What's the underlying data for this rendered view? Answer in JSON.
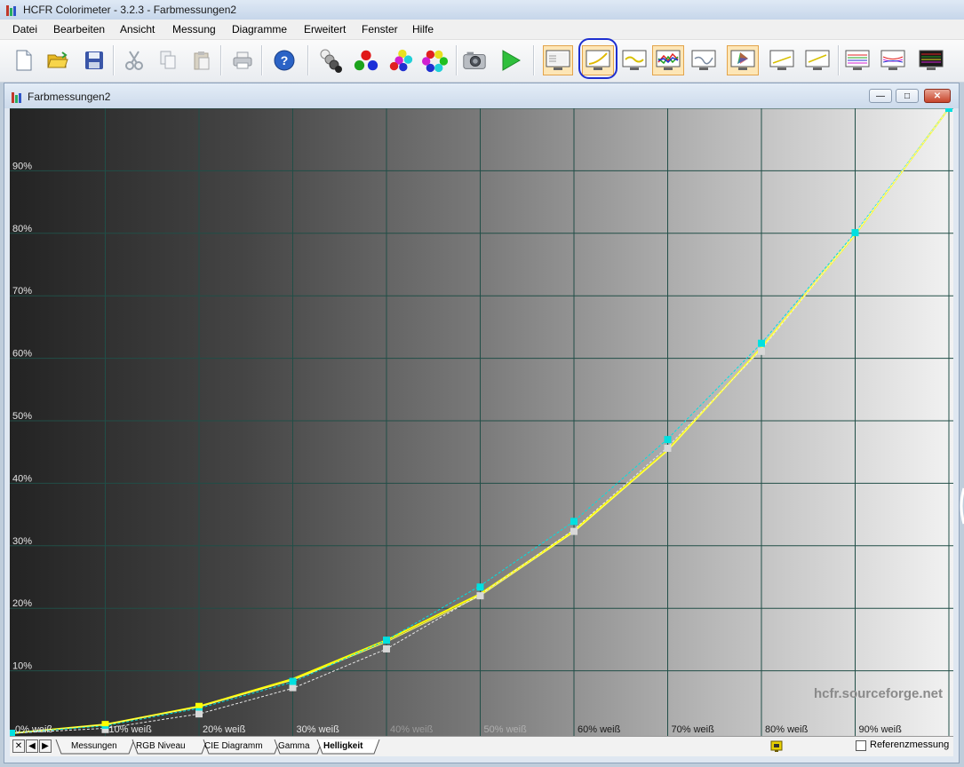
{
  "app": {
    "window_title": "HCFR Colorimeter - 3.2.3 - Farbmessungen2",
    "menu": [
      {
        "label": "Datei"
      },
      {
        "label": "Bearbeiten"
      },
      {
        "label": "Ansicht"
      },
      {
        "label": "Messung"
      },
      {
        "label": "Diagramme"
      },
      {
        "label": "Erweitert"
      },
      {
        "label": "Fenster"
      },
      {
        "label": "Hilfe"
      }
    ],
    "toolbar_icons": [
      "new-document-icon",
      "open-folder-icon",
      "save-disk-icon",
      "cut-icon",
      "copy-icon",
      "paste-icon",
      "print-icon",
      "help-icon",
      "grayscale-measure-icon",
      "primary-colors-icon",
      "secondary-colors-icon",
      "all-colors-icon",
      "camera-icon",
      "play-icon",
      "view-measures-icon",
      "view-luminance-icon",
      "view-gamma-icon",
      "view-rgb-levels-icon",
      "view-color-temp-icon",
      "view-cie-icon",
      "view-near-black-icon",
      "view-near-white-icon",
      "view-saturation-icon",
      "view-saturation-shift-icon",
      "view-measures-colors-icon"
    ]
  },
  "child_window": {
    "title": "Farbmessungen2",
    "watermark": "hcfr.sourceforge.net"
  },
  "chart_data": {
    "type": "line",
    "y_tick_labels": [
      "10%",
      "20%",
      "30%",
      "40%",
      "50%",
      "60%",
      "70%",
      "80%",
      "90%"
    ],
    "x_tick_labels": [
      "0% weiß",
      "10% weiß",
      "20% weiß",
      "30% weiß",
      "40% weiß",
      "50% weiß",
      "60% weiß",
      "70% weiß",
      "80% weiß",
      "90% weiß"
    ],
    "xlim": [
      0,
      100
    ],
    "ylim": [
      0,
      100
    ],
    "grid": true,
    "colors": {
      "measured": "#ffff00",
      "reference": "#ffff66",
      "cyan": "#00e0e0",
      "white": "#e8e8e8"
    },
    "series": [
      {
        "key": "measured",
        "color": "#ffff00",
        "x": [
          0,
          10,
          20,
          30,
          40,
          50,
          60,
          70,
          80,
          90,
          100
        ],
        "y": [
          0,
          1.4,
          4.3,
          8.7,
          14.9,
          22.3,
          32.4,
          45.3,
          61.7,
          79.8,
          100
        ]
      },
      {
        "key": "reference",
        "color": "#ffff66",
        "x": [
          0,
          10,
          20,
          30,
          40,
          50,
          60,
          70,
          80,
          90,
          100
        ],
        "y": [
          0,
          1.4,
          4.2,
          8.5,
          14.6,
          22.0,
          32.2,
          45.2,
          61.7,
          79.8,
          100
        ]
      },
      {
        "key": "cyan",
        "color": "#00e0e0",
        "x": [
          0,
          10,
          20,
          30,
          40,
          50,
          60,
          70,
          80,
          90,
          100
        ],
        "y": [
          0,
          1.2,
          4.0,
          8.2,
          14.9,
          23.6,
          33.9,
          47.1,
          62.4,
          80.1,
          100
        ]
      },
      {
        "key": "white",
        "color": "#e8e8e8",
        "x": [
          0,
          10,
          20,
          30,
          40,
          50,
          60,
          70,
          80,
          90,
          100
        ],
        "y": [
          0,
          0.8,
          3.1,
          7.2,
          13.5,
          22.2,
          32.6,
          45.8,
          61.4,
          79.9,
          100
        ]
      }
    ],
    "markers_cyan": {
      "x": [
        0,
        10,
        20,
        30,
        40,
        50,
        60,
        70,
        80,
        90,
        100
      ],
      "y": [
        0,
        1.3,
        4.2,
        8.3,
        14.9,
        23.4,
        33.9,
        47.0,
        62.4,
        80.1,
        100
      ]
    },
    "markers_white": {
      "x": [
        10,
        20,
        30,
        40,
        50,
        60,
        70,
        80
      ],
      "y": [
        0.6,
        3.1,
        7.3,
        13.5,
        22.0,
        32.3,
        45.6,
        61.1
      ]
    }
  },
  "tabs": {
    "items": [
      {
        "label": "Messungen"
      },
      {
        "label": "RGB Niveau"
      },
      {
        "label": "CIE Diagramm"
      },
      {
        "label": "Gamma"
      },
      {
        "label": "Helligkeit"
      }
    ],
    "active": "Helligkeit",
    "reference_checkbox": "Referenzmessung"
  }
}
